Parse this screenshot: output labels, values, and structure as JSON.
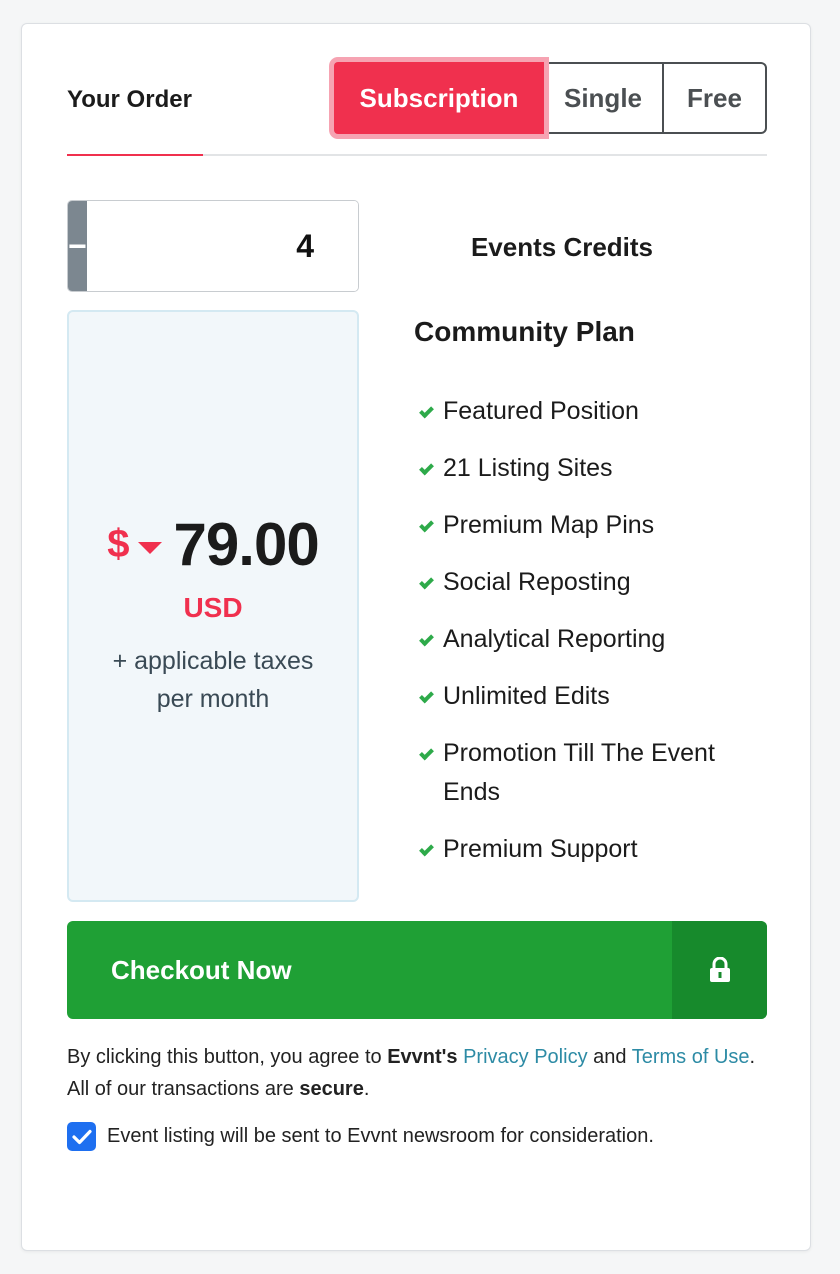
{
  "order": {
    "title": "Your Order",
    "tabs": [
      {
        "label": "Subscription",
        "active": true
      },
      {
        "label": "Single",
        "active": false
      },
      {
        "label": "Free",
        "active": false
      }
    ]
  },
  "quantity": {
    "minus_label": "−",
    "value": "4",
    "plus_label": "+",
    "unit_label": "Events Credits"
  },
  "price": {
    "currency_symbol": "$",
    "amount": "79.00",
    "currency_code": "USD",
    "tax_note": "+ applicable taxes",
    "period": "per month"
  },
  "plan": {
    "name": "Community Plan",
    "features": [
      "Featured Position",
      "21 Listing Sites",
      "Premium Map Pins",
      "Social Reposting",
      "Analytical Reporting",
      "Unlimited Edits",
      "Promotion Till The Event Ends",
      "Premium Support"
    ]
  },
  "checkout": {
    "label": "Checkout Now",
    "icon": "lock-icon"
  },
  "legal": {
    "prefix": "By clicking this button, you agree to ",
    "brand": "Evvnt's",
    "privacy_link": "Privacy Policy",
    "and": " and ",
    "terms_link": "Terms of Use",
    "middle": ". All of our transactions are ",
    "secure": "secure",
    "suffix": "."
  },
  "consent": {
    "checked": true,
    "label": "Event listing will be sent to Evvnt newsroom for consideration."
  },
  "colors": {
    "accent": "#f0304e",
    "success": "#1fa035",
    "link": "#2d8ba5",
    "checkbox": "#1e6ff0"
  }
}
